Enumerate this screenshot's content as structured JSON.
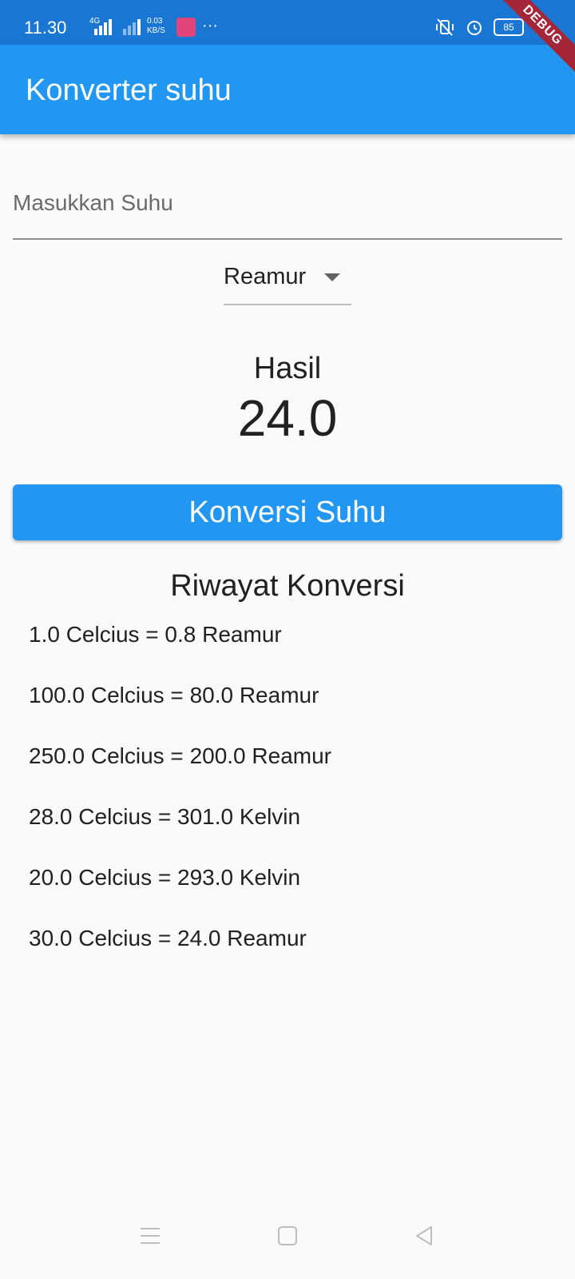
{
  "status_bar": {
    "time": "11.30",
    "network": "4G",
    "speed_value": "0.03",
    "speed_unit": "KB/S",
    "overflow": "···",
    "battery": "85"
  },
  "debug_banner": "DEBUG",
  "app_bar": {
    "title": "Konverter suhu"
  },
  "input": {
    "placeholder": "Masukkan Suhu",
    "value": ""
  },
  "dropdown": {
    "selected": "Reamur"
  },
  "result": {
    "label": "Hasil",
    "value": "24.0"
  },
  "convert_button": {
    "label": "Konversi Suhu"
  },
  "history": {
    "title": "Riwayat Konversi",
    "items": [
      "1.0 Celcius = 0.8 Reamur",
      "100.0 Celcius = 80.0 Reamur",
      "250.0 Celcius = 200.0 Reamur",
      "28.0 Celcius = 301.0 Kelvin",
      "20.0 Celcius = 293.0 Kelvin",
      "30.0 Celcius = 24.0 Reamur"
    ]
  },
  "colors": {
    "app_bar": "#2196f3",
    "status_bar": "#1976d2",
    "debug_banner": "#a62639"
  },
  "icons": [
    "mute-vibrate-icon",
    "alarm-icon",
    "battery-icon",
    "charging-icon",
    "menu-icon",
    "home-icon",
    "back-icon"
  ]
}
